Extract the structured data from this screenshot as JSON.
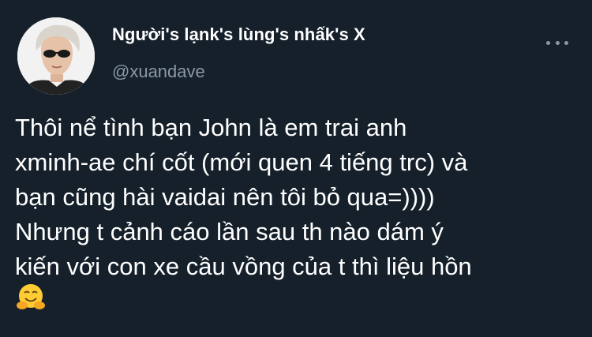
{
  "tweet": {
    "display_name": "Người's lạnk's lùng's nhấk's X",
    "handle": "@xuandave",
    "text_lines": [
      "Thôi nể tình bạn John là em trai anh",
      "xminh-ae chí cốt (mới quen 4 tiếng trc) và",
      "bạn cũng hài vaidai nên tôi bỏ qua=))))",
      "Nhưng t cảnh cáo lần sau th nào dám ý",
      "kiến với con xe cầu vồng của t thì liệu hồn"
    ],
    "emoji": "hugging-face-emoji",
    "avatar": "profile-photo",
    "more_icon": "more-options-icon"
  },
  "colors": {
    "background": "#15202b",
    "text": "#ffffff",
    "secondary_text": "#8899a6"
  }
}
